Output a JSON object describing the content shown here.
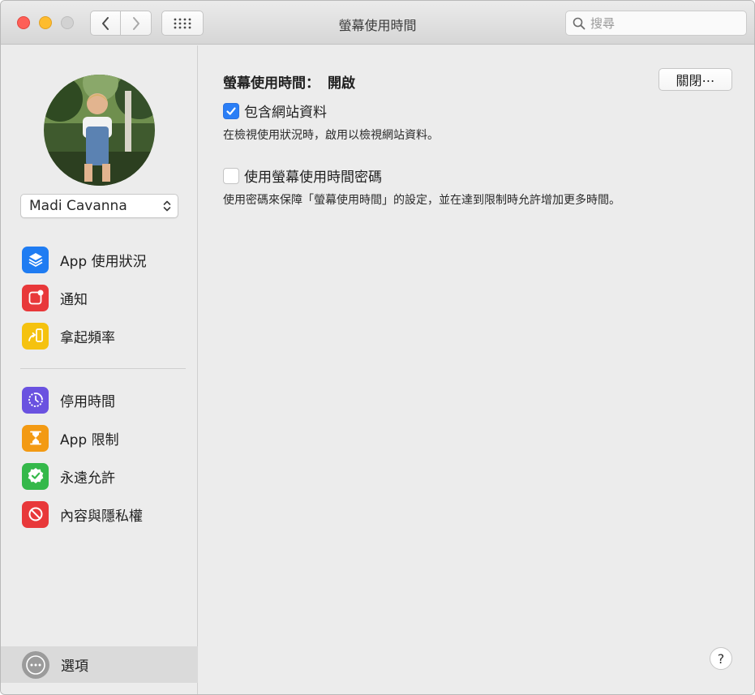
{
  "window": {
    "title": "螢幕使用時間"
  },
  "search": {
    "placeholder": "搜尋"
  },
  "user": {
    "name": "Madi Cavanna"
  },
  "sidebar": {
    "group1": [
      {
        "label": "App 使用狀況",
        "icon": "layers-icon",
        "color": "#1f7cf2"
      },
      {
        "label": "通知",
        "icon": "notification-icon",
        "color": "#e8383a"
      },
      {
        "label": "拿起頻率",
        "icon": "pickup-icon",
        "color": "#f5c20f"
      }
    ],
    "group2": [
      {
        "label": "停用時間",
        "icon": "downtime-icon",
        "color": "#6a52e0"
      },
      {
        "label": "App 限制",
        "icon": "hourglass-icon",
        "color": "#f39a13"
      },
      {
        "label": "永遠允許",
        "icon": "checkmark-badge-icon",
        "color": "#34b84a"
      },
      {
        "label": "內容與隱私權",
        "icon": "no-entry-icon",
        "color": "#e8383a"
      }
    ],
    "options_label": "選項"
  },
  "main": {
    "status_label": "螢幕使用時間：",
    "status_value": "開啟",
    "off_button": "關閉⋯",
    "include_websites": {
      "label": "包含網站資料",
      "checked": true,
      "description": "在檢視使用狀況時，啟用以檢視網站資料。"
    },
    "use_passcode": {
      "label": "使用螢幕使用時間密碼",
      "checked": false,
      "description": "使用密碼來保障「螢幕使用時間」的設定，並在達到限制時允許增加更多時間。"
    },
    "help_label": "?"
  }
}
